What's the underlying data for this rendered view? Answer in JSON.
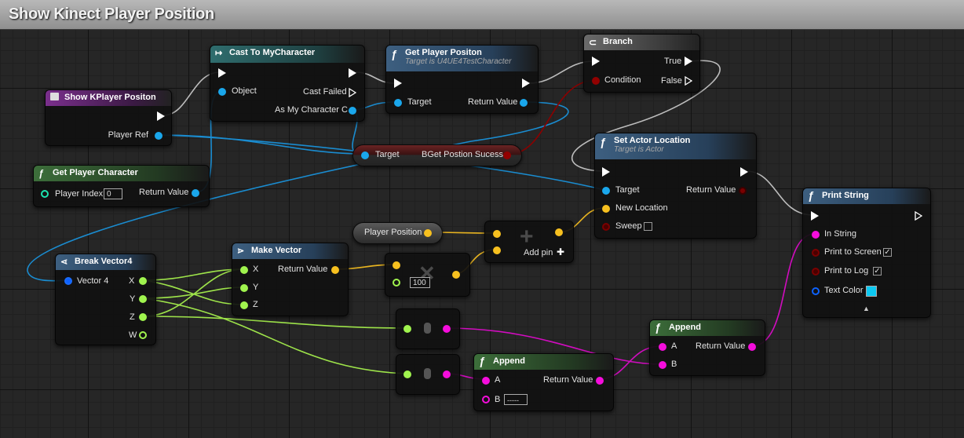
{
  "window": {
    "title": "Show Kinect Player Position"
  },
  "colors": {
    "exec": "#ffffff",
    "object": "#1aa7ec",
    "bool": "#920101",
    "vector": "#f7c01f",
    "float": "#a0f44e",
    "string": "#f50ddc",
    "color": "#0d62ff",
    "int": "#1ce5b1"
  },
  "nodes": {
    "show_kplayer": {
      "title": "Show KPlayer Positon",
      "player_ref": "Player Ref"
    },
    "get_player_character": {
      "title": "Get Player Character",
      "player_index": "Player Index",
      "player_index_value": "0",
      "return_value": "Return Value"
    },
    "cast_to": {
      "title": "Cast To MyCharacter",
      "object": "Object",
      "cast_failed": "Cast Failed",
      "as_my_character": "As My Character C"
    },
    "get_player_position": {
      "title": "Get Player Positon",
      "subtitle": "Target is U4UE4TestCharacter",
      "target": "Target",
      "return_value": "Return Value"
    },
    "branch": {
      "title": "Branch",
      "condition": "Condition",
      "true_label": "True",
      "false_label": "False"
    },
    "bget_var": {
      "target": "Target",
      "label": "BGet Postion Sucess"
    },
    "set_actor_location": {
      "title": "Set Actor Location",
      "subtitle": "Target is Actor",
      "target": "Target",
      "return_value": "Return Value",
      "new_location": "New Location",
      "sweep": "Sweep"
    },
    "print_string": {
      "title": "Print String",
      "in_string": "In String",
      "print_to_screen": "Print to Screen",
      "print_to_log": "Print to Log",
      "text_color": "Text Color",
      "text_color_value": "#0cc9f2",
      "expand_arrow": "▲"
    },
    "player_position_var": {
      "label": "Player Position"
    },
    "add_node": {
      "add_pin": "Add pin",
      "plus_icon": "+",
      "add_pin_icon": "✚"
    },
    "break_vector": {
      "title": "Break Vector4",
      "vector": "Vector 4",
      "x": "X",
      "y": "Y",
      "z": "Z",
      "w": "W"
    },
    "make_vector": {
      "title": "Make Vector",
      "x": "X",
      "y": "Y",
      "z": "Z",
      "return_value": "Return Value"
    },
    "multiply_node": {
      "value": "100",
      "icon": "✕"
    },
    "append_1": {
      "title": "Append",
      "a": "A",
      "b": "B",
      "return_value": "Return Value"
    },
    "append_2": {
      "title": "Append",
      "a": "A",
      "b": "B",
      "b_value": "-----",
      "return_value": "Return Value"
    }
  }
}
